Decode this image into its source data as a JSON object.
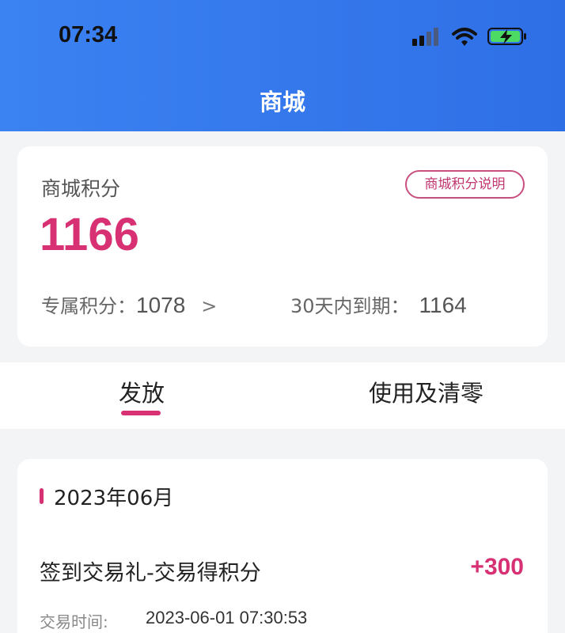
{
  "status_bar": {
    "time": "07:34",
    "icons": [
      "signal-icon",
      "wifi-icon",
      "battery-charging-icon"
    ],
    "battery_color": "#4cd964"
  },
  "nav": {
    "title": "商城"
  },
  "points_card": {
    "label": "商城积分",
    "explain_button": "商城积分说明",
    "total": "1166",
    "exclusive_label": "专属积分：",
    "exclusive_value": "1078",
    "exclusive_arrow": ">",
    "expire_label": "30天内到期：",
    "expire_value": "1164"
  },
  "tabs": [
    {
      "label": "发放",
      "active": true
    },
    {
      "label": "使用及清零",
      "active": false
    }
  ],
  "records": {
    "month": "2023年06月",
    "items": [
      {
        "title": "签到交易礼-交易得积分",
        "points": "+300",
        "time_label": "交易时间:",
        "time_value": "2023-06-01 07:30:53"
      }
    ]
  },
  "colors": {
    "header_blue": "#3b82f2",
    "accent_pink": "#d73173",
    "background": "#f3f4f6"
  }
}
